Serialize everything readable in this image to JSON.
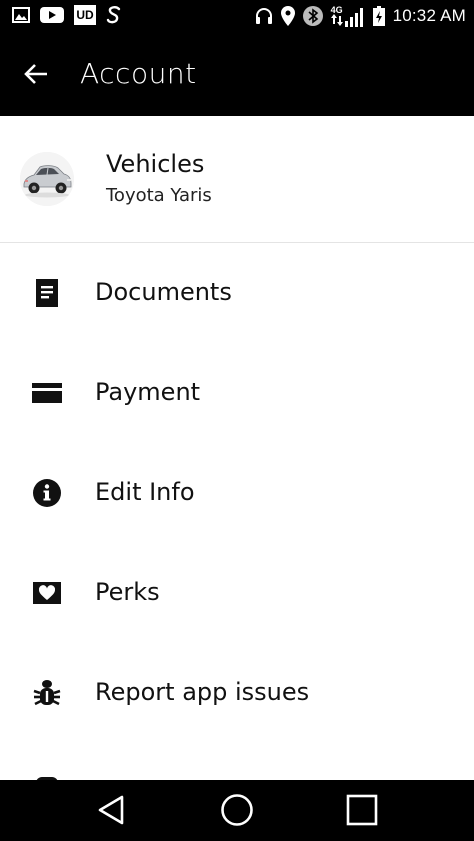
{
  "status_bar": {
    "time": "10:32 AM",
    "left_icons": [
      "gallery-icon",
      "youtube-icon",
      "ud-icon",
      "s-app-icon"
    ],
    "ud_label": "UD",
    "right_icons": [
      "headphones-icon",
      "location-icon",
      "bluetooth-icon",
      "signal-4g-icon",
      "battery-icon"
    ],
    "net_label": "4G"
  },
  "app_bar": {
    "title": "Account"
  },
  "vehicle": {
    "title": "Vehicles",
    "subtitle": "Toyota Yaris"
  },
  "menu": {
    "items": [
      {
        "label": "Documents",
        "icon": "document-icon"
      },
      {
        "label": "Payment",
        "icon": "card-icon"
      },
      {
        "label": "Edit Info",
        "icon": "info-icon"
      },
      {
        "label": "Perks",
        "icon": "heart-tag-icon"
      },
      {
        "label": "Report app issues",
        "icon": "bug-icon"
      }
    ]
  },
  "nav_bar": {
    "buttons": [
      "back-triangle-icon",
      "home-circle-icon",
      "recents-square-icon"
    ]
  }
}
